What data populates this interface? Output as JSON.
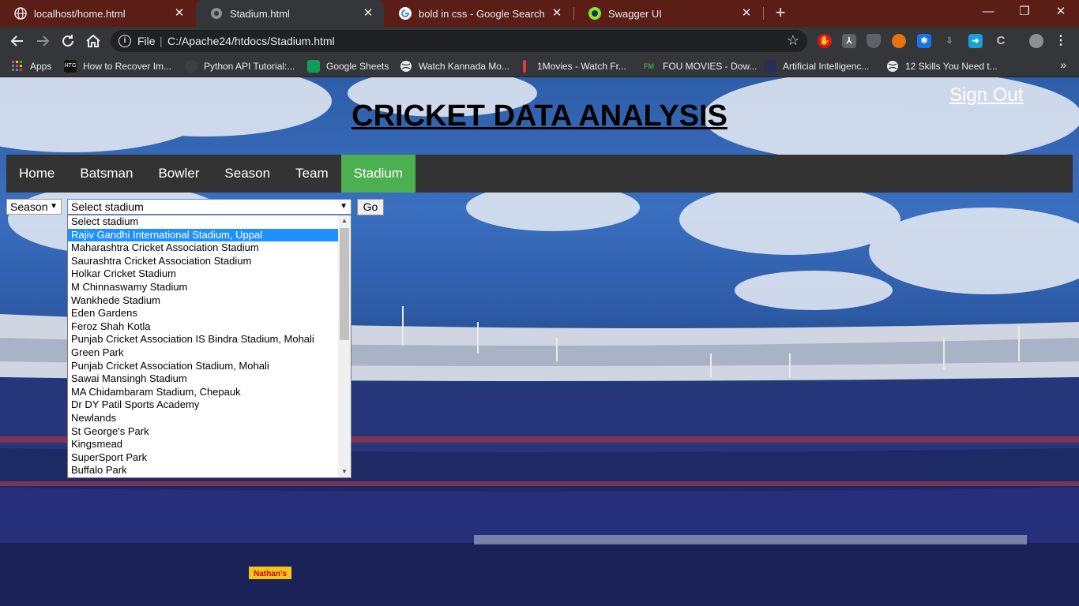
{
  "browser": {
    "tabs": [
      {
        "title": "localhost/home.html",
        "icon": "globe-icon",
        "active": false
      },
      {
        "title": "Stadium.html",
        "icon": "globe-icon",
        "active": true
      },
      {
        "title": "bold in css - Google Search",
        "icon": "google-icon",
        "active": false
      },
      {
        "title": "Swagger UI",
        "icon": "swagger-icon",
        "active": false
      }
    ],
    "close_glyph": "✕",
    "new_tab_glyph": "+",
    "window_controls": {
      "minimize": "—",
      "restore": "❐",
      "close": "✕"
    },
    "address_bar": {
      "scheme_label": "File",
      "separator": "|",
      "url": "C:/Apache24/htdocs/Stadium.html"
    },
    "bookmarks": [
      {
        "label": "Apps",
        "icon": "apps-grid-icon"
      },
      {
        "label": "How to Recover Im...",
        "icon": "htg-icon"
      },
      {
        "label": "Python API Tutorial:...",
        "icon": "lock-icon"
      },
      {
        "label": "Google Sheets",
        "icon": "sheets-icon"
      },
      {
        "label": "Watch Kannada Mo...",
        "icon": "globe-icon"
      },
      {
        "label": "1Movies - Watch Fr...",
        "icon": "bar-icon"
      },
      {
        "label": "FOU MOVIES - Dow...",
        "icon": "fm-icon"
      },
      {
        "label": "Artificial Intelligenc...",
        "icon": "ai-icon"
      },
      {
        "label": "12 Skills You Need t...",
        "icon": "globe-icon"
      }
    ],
    "bookmarks_more": "»"
  },
  "page": {
    "title": "CRICKET DATA ANALYSIS",
    "sign_out": "Sign Out",
    "nav": [
      {
        "label": "Home",
        "active": false
      },
      {
        "label": "Batsman",
        "active": false
      },
      {
        "label": "Bowler",
        "active": false
      },
      {
        "label": "Season",
        "active": false
      },
      {
        "label": "Team",
        "active": false
      },
      {
        "label": "Stadium",
        "active": true
      }
    ],
    "season_select": {
      "value": "Season"
    },
    "stadium_select": {
      "value": "Select stadium",
      "options": [
        "Select stadium",
        "Rajiv Gandhi International Stadium, Uppal",
        "Maharashtra Cricket Association Stadium",
        "Saurashtra Cricket Association Stadium",
        "Holkar Cricket Stadium",
        "M Chinnaswamy Stadium",
        "Wankhede Stadium",
        "Eden Gardens",
        "Feroz Shah Kotla",
        "Punjab Cricket Association IS Bindra Stadium, Mohali",
        "Green Park",
        "Punjab Cricket Association Stadium, Mohali",
        "Sawai Mansingh Stadium",
        "MA Chidambaram Stadium, Chepauk",
        "Dr DY Patil Sports Academy",
        "Newlands",
        "St George's Park",
        "Kingsmead",
        "SuperSport Park",
        "Buffalo Park"
      ],
      "highlighted_index": 1
    },
    "go_label": "Go",
    "banner_text": "Nathan's"
  },
  "colors": {
    "nav_bg": "#333333",
    "nav_active": "#4CAF50",
    "highlight": "#1e90ff",
    "tabstrip": "#5a1e16"
  }
}
